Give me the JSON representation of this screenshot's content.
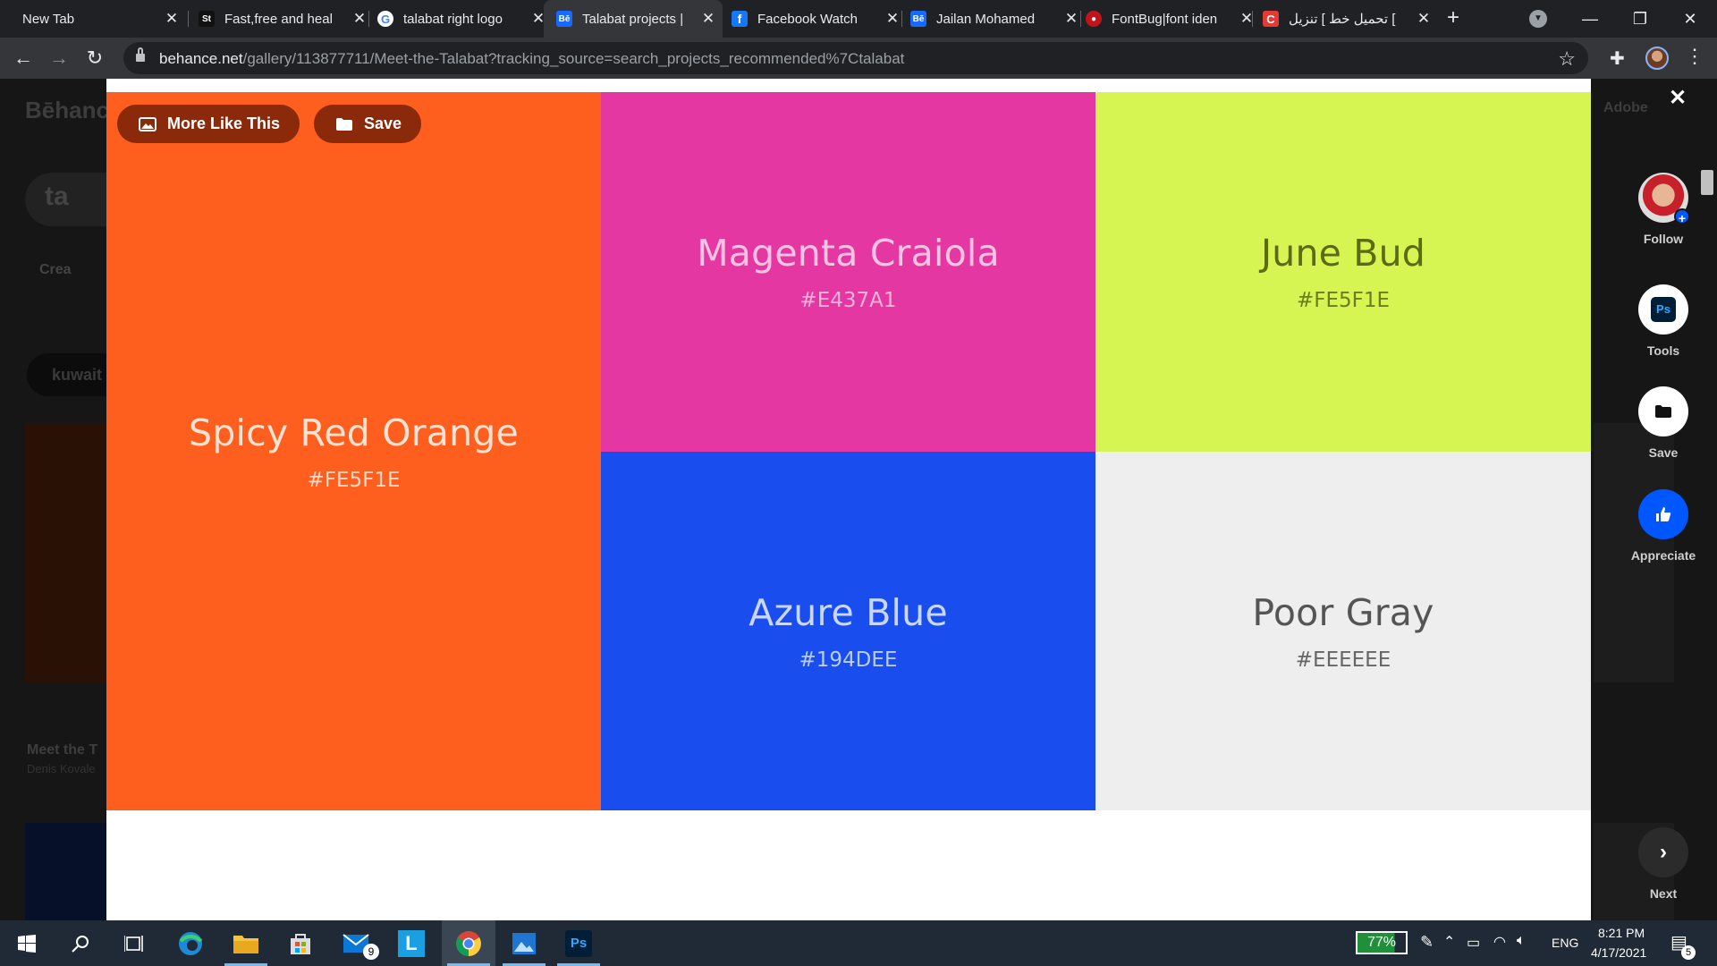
{
  "browser": {
    "tabs": [
      {
        "title": "New Tab",
        "favicon": "none"
      },
      {
        "title": "Fast,free and heal",
        "favicon": "st-icon"
      },
      {
        "title": "talabat right logo",
        "favicon": "google-icon"
      },
      {
        "title": "Talabat projects | ",
        "favicon": "behance-icon"
      },
      {
        "title": "Facebook Watch",
        "favicon": "facebook-icon"
      },
      {
        "title": "Jailan Mohamed",
        "favicon": "behance-icon"
      },
      {
        "title": "FontBug|font iden",
        "favicon": "fontbug-icon"
      },
      {
        "title": "تحميل خط ] تنزيل [",
        "favicon": "red-c-icon"
      }
    ],
    "url_host": "behance.net",
    "url_path": "/gallery/113877711/Meet-the-Talabat?tracking_source=search_projects_recommended%7Ctalabat"
  },
  "background_page": {
    "logo": "Bēhance",
    "adobe": "Adobe",
    "search_text": "ta",
    "create": "Crea",
    "pill": "kuwait",
    "caption_title": "Meet the T",
    "caption_author": "Denis Kovale"
  },
  "modal": {
    "more_like_this_label": "More Like This",
    "save_label": "Save",
    "swatches": [
      {
        "name": "Spicy Red Orange",
        "hex": "#FE5F1E",
        "bg": "#FE5F1E",
        "fg": "#FFE2D2",
        "hexfg": "#FFD7C2"
      },
      {
        "name": "Magenta Craiola",
        "hex": "#E437A1",
        "bg": "#E437A1",
        "fg": "#F8C3E2",
        "hexfg": "#F3B3D9"
      },
      {
        "name": "June Bud",
        "hex": "#FE5F1E",
        "bg": "#D6F552",
        "fg": "#5A6B14",
        "hexfg": "#6B7D1E"
      },
      {
        "name": "Azure Blue",
        "hex": "#194DEE",
        "bg": "#194DEE",
        "fg": "#C9D7FF",
        "hexfg": "#BACBFF"
      },
      {
        "name": "Poor Gray",
        "hex": "#EEEEEE",
        "bg": "#EEEEEE",
        "fg": "#555555",
        "hexfg": "#666666"
      }
    ]
  },
  "rail": {
    "follow": "Follow",
    "tools": "Tools",
    "tools_badge": "Ps",
    "save": "Save",
    "appreciate": "Appreciate",
    "next": "Next"
  },
  "taskbar": {
    "battery": "77%",
    "language": "ENG",
    "time": "8:21 PM",
    "date": "4/17/2021",
    "mail_badge": "9",
    "notifications": "5"
  },
  "colors": {
    "accent_blue": "#0057FF",
    "modal_button": "#8A2A0A"
  }
}
